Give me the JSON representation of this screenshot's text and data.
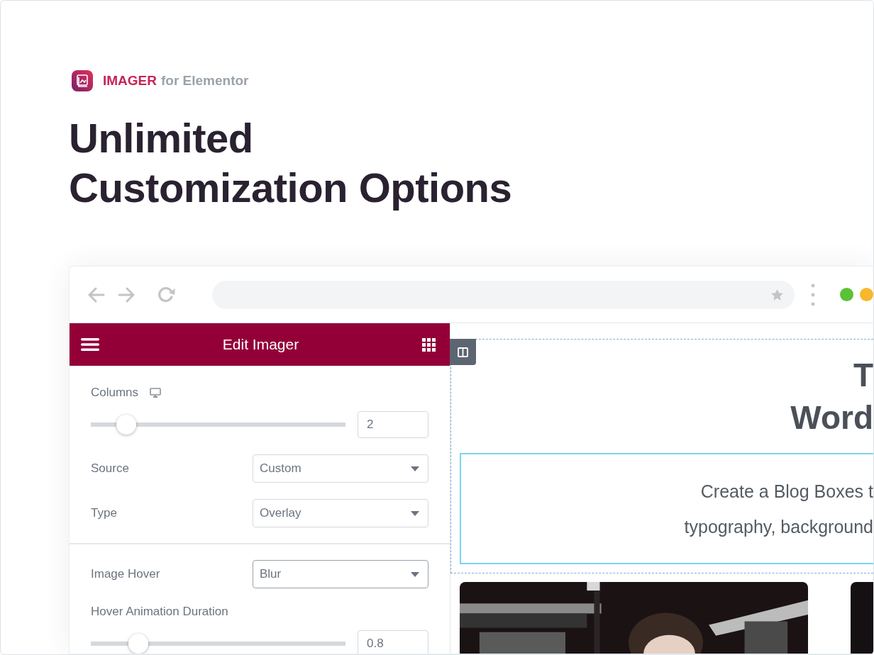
{
  "brand": {
    "name": "IMAGER",
    "suffix": "for Elementor"
  },
  "headline": [
    "Unlimited",
    "Customization Options"
  ],
  "browser": {
    "lights": [
      {
        "color": "#5bc236"
      },
      {
        "color": "#f8b72c"
      }
    ]
  },
  "editor": {
    "title": "Edit Imager",
    "sections": [
      [
        {
          "kind": "slider",
          "label": "Columns",
          "responsive": true,
          "level": 0.11,
          "value": "2"
        },
        {
          "kind": "select",
          "label": "Source",
          "value": "Custom",
          "focused": false
        },
        {
          "kind": "select",
          "label": "Type",
          "value": "Overlay",
          "focused": false
        }
      ],
      [
        {
          "kind": "select",
          "label": "Image Hover",
          "value": "Blur",
          "focused": true
        },
        {
          "kind": "slider",
          "label": "Hover Animation Duration",
          "responsive": false,
          "level": 0.16,
          "value": "0.8"
        }
      ]
    ]
  },
  "preview": {
    "heading": [
      "T",
      "Word"
    ],
    "text": [
      "Create a Blog Boxes t",
      "typography, background"
    ],
    "cards": [
      {
        "kind": "picture"
      },
      {
        "kind": "picture"
      }
    ]
  }
}
